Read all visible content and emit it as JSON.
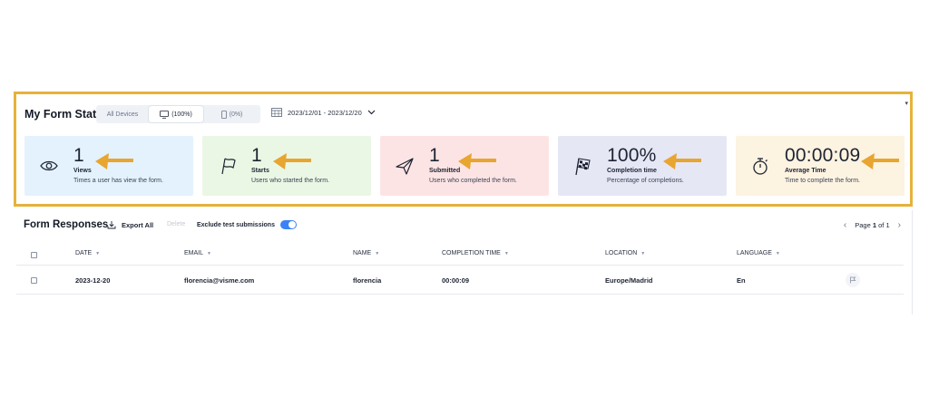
{
  "stats": {
    "title": "My Form Stats",
    "devices": [
      {
        "label": "All Devices"
      },
      {
        "label": "(100%)",
        "icon": "desktop-icon",
        "selected": true
      },
      {
        "label": "(0%)",
        "icon": "mobile-icon"
      }
    ],
    "date_range": "2023/12/01 - 2023/12/20",
    "cards": [
      {
        "value": "1",
        "label": "Views",
        "desc": "Times a user has view the form.",
        "icon": "eye-icon",
        "bg": "#e3f2fd"
      },
      {
        "value": "1",
        "label": "Starts",
        "desc": "Users who started the form.",
        "icon": "flag-icon",
        "bg": "#eaf7e4"
      },
      {
        "value": "1",
        "label": "Submitted",
        "desc": "Users who completed the form.",
        "icon": "paper-plane-icon",
        "bg": "#fde4e4"
      },
      {
        "value": "100%",
        "label": "Completion time",
        "desc": "Percentage of completions.",
        "icon": "checkered-flag-icon",
        "bg": "#e6e7f5"
      },
      {
        "value": "00:00:09",
        "label": "Average Time",
        "desc": "Time to complete the form.",
        "icon": "stopwatch-icon",
        "bg": "#fdf3e1"
      }
    ],
    "highlight_color": "#e6b23b",
    "arrow_color": "#e8a530"
  },
  "responses": {
    "title": "Form Responses",
    "export_label": "Export All",
    "delete_label": "Delete",
    "exclude_label": "Exclude test submissions",
    "exclude_enabled": true,
    "pager": {
      "prefix": "Page",
      "current": "1",
      "sep": "of",
      "total": "1"
    },
    "columns": [
      "DATE",
      "EMAIL",
      "NAME",
      "COMPLETION TIME",
      "LOCATION",
      "LANGUAGE"
    ],
    "rows": [
      {
        "date": "2023-12-20",
        "email": "florencia@visme.com",
        "name": "florencia",
        "completion": "00:00:09",
        "location": "Europe/Madrid",
        "language": "En"
      }
    ]
  }
}
